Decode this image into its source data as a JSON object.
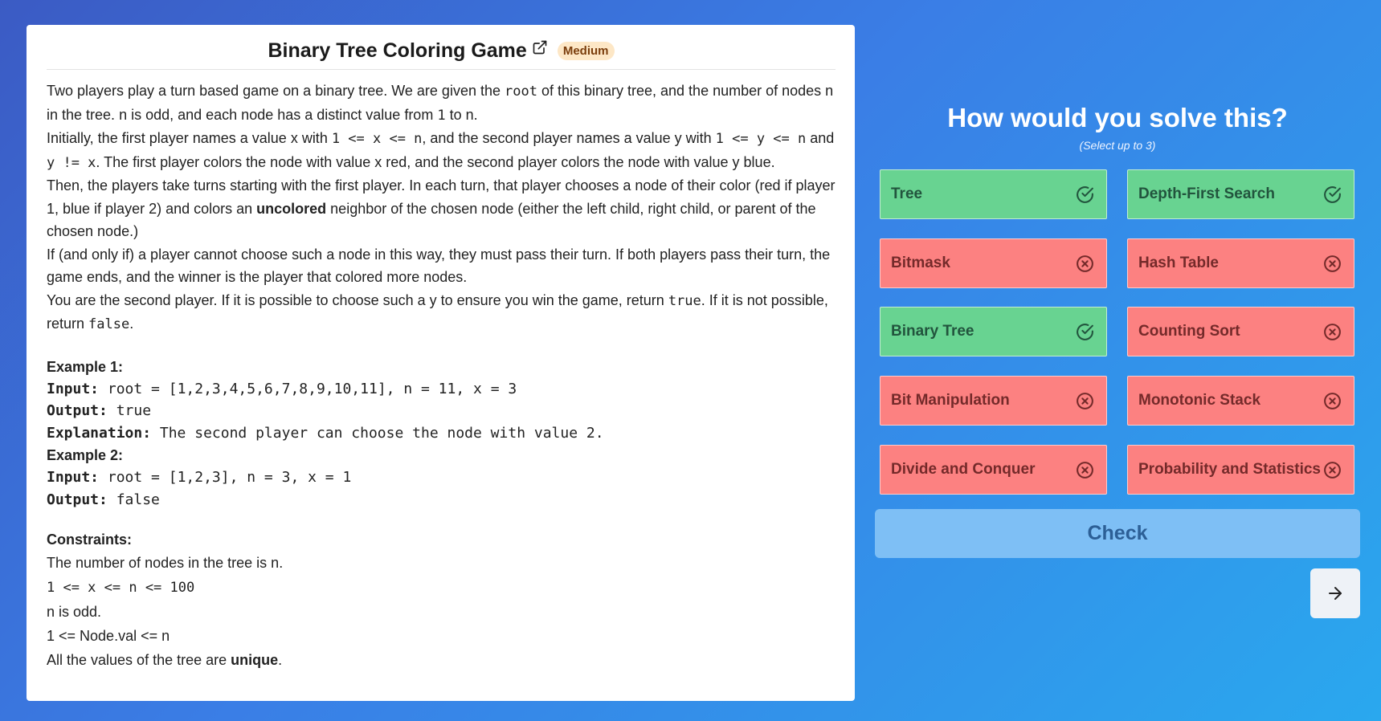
{
  "problem": {
    "title": "Binary Tree Coloring Game",
    "difficulty": "Medium",
    "desc": {
      "p1a": "Two players play a turn based game on a binary tree. We are given the ",
      "p1_code_root": "root",
      "p1b": " of this binary tree, and the number of nodes ",
      "p1_n1": "n",
      "p1c": " in the tree. ",
      "p1_n2": "n",
      "p1d": " is odd, and each node has a distinct value from ",
      "p1_one": "1",
      "p1e": " to ",
      "p1_n3": "n",
      "p1f": ".",
      "p2a": "Initially, the first player names a value ",
      "p2_x": "x",
      "p2b": " with ",
      "p2_code1": "1 <= x <= n",
      "p2c": ", and the second player names a value ",
      "p2_y": "y",
      "p2d": " with ",
      "p2_code2": "1 <= y <= n",
      "p2e": " and ",
      "p2_code3": "y != x",
      "p2f": ". The first player colors the node with value ",
      "p2_x2": "x",
      "p2g": " red, and the second player colors the node with value ",
      "p2_y2": "y",
      "p2h": " blue.",
      "p3a": "Then, the players take turns starting with the first player. In each turn, that player chooses a node of their color (red if player 1, blue if player 2) and colors an ",
      "p3_bold": "uncolored",
      "p3b": " neighbor of the chosen node (either the left child, right child, or parent of the chosen node.)",
      "p4": "If (and only if) a player cannot choose such a node in this way, they must pass their turn. If both players pass their turn, the game ends, and the winner is the player that colored more nodes.",
      "p5a": "You are the second player. If it is possible to choose such a ",
      "p5_y": "y",
      "p5b": " to ensure you win the game, return ",
      "p5_true": "true",
      "p5c": ". If it is not possible, return ",
      "p5_false": "false",
      "p5d": "."
    },
    "examples": [
      {
        "title": "Example 1:",
        "input_label": "Input:",
        "input": " root = [1,2,3,4,5,6,7,8,9,10,11], n = 11, x = 3",
        "output_label": "Output:",
        "output": " true",
        "explanation_label": "Explanation:",
        "explanation": " The second player can choose the node with value 2."
      },
      {
        "title": "Example 2:",
        "input_label": "Input:",
        "input": " root = [1,2,3], n = 3, x = 1",
        "output_label": "Output:",
        "output": " false"
      }
    ],
    "constraints_title": "Constraints:",
    "constraints": {
      "c1a": "The number of nodes in the tree is ",
      "c1_n": "n",
      "c1b": ".",
      "c2": "1 <= x <= n <= 100",
      "c3_n": "n",
      "c3b": " is odd.",
      "c4": "1 <= Node.val <= n",
      "c5a": "All the values of the tree are ",
      "c5_bold": "unique",
      "c5b": "."
    }
  },
  "quiz": {
    "question": "How would you solve this?",
    "subtitle": "(Select up to 3)",
    "options": [
      {
        "label": "Tree",
        "state": "correct",
        "icon": "check-circle-icon"
      },
      {
        "label": "Depth-First Search",
        "state": "correct",
        "icon": "check-circle-icon"
      },
      {
        "label": "Bitmask",
        "state": "wrong",
        "icon": "x-circle-icon"
      },
      {
        "label": "Hash Table",
        "state": "wrong",
        "icon": "x-circle-icon"
      },
      {
        "label": "Binary Tree",
        "state": "correct",
        "icon": "check-circle-icon"
      },
      {
        "label": "Counting Sort",
        "state": "wrong",
        "icon": "x-circle-icon"
      },
      {
        "label": "Bit Manipulation",
        "state": "wrong",
        "icon": "x-circle-icon"
      },
      {
        "label": "Monotonic Stack",
        "state": "wrong",
        "icon": "x-circle-icon"
      },
      {
        "label": "Divide and Conquer",
        "state": "wrong",
        "icon": "x-circle-icon"
      },
      {
        "label": "Probability and Statistics",
        "state": "wrong",
        "icon": "x-circle-icon"
      }
    ],
    "check_label": "Check",
    "next_icon": "arrow-right-icon"
  },
  "colors": {
    "correct_bg": "#68d391",
    "wrong_bg": "#fc8181",
    "badge_bg": "#fde7c6",
    "check_bg": "#7ebff5"
  }
}
